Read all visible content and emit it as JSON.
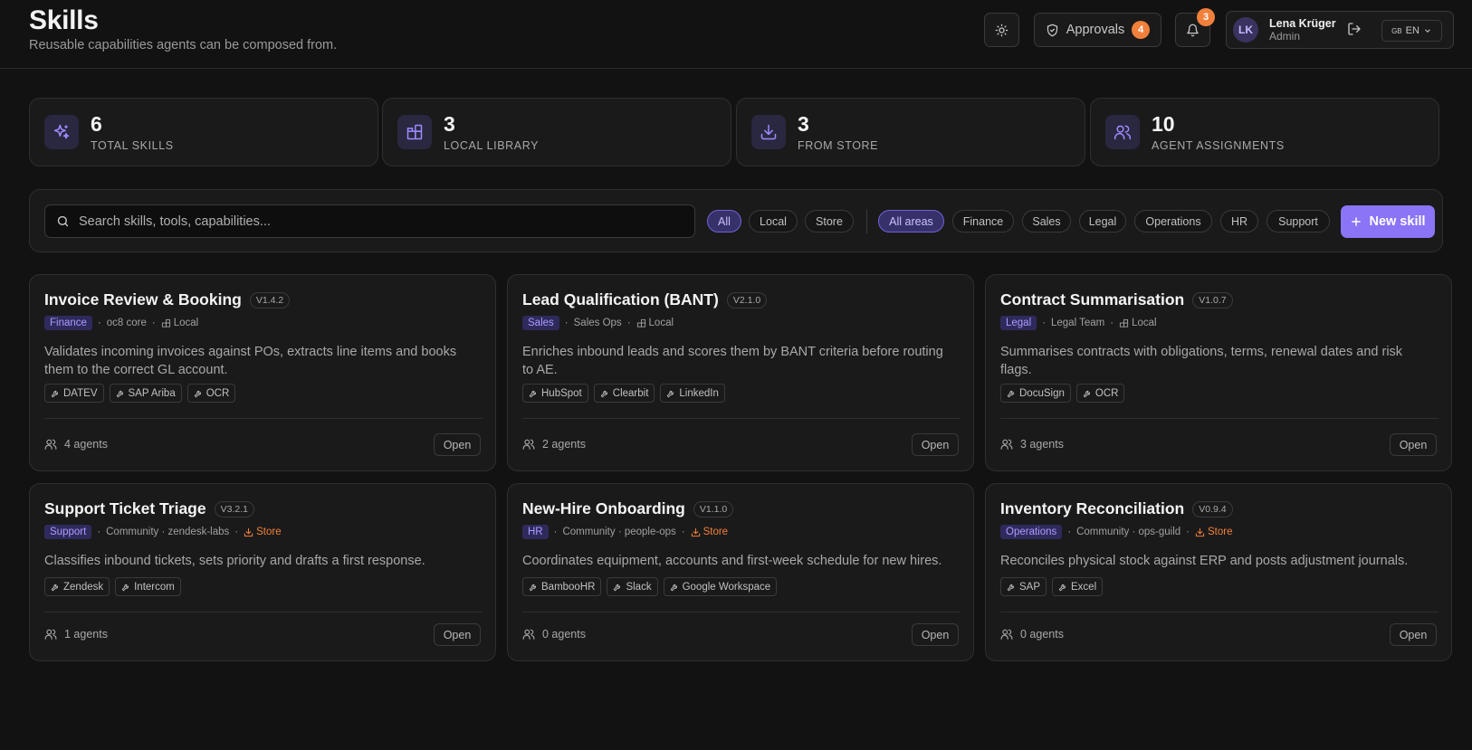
{
  "header": {
    "title": "Skills",
    "subtitle": "Reusable capabilities agents can be composed from.",
    "approvals_label": "Approvals",
    "approvals_count": "4",
    "notifications_count": "3",
    "user": {
      "initials": "LK",
      "name": "Lena Krüger",
      "role": "Admin"
    },
    "language": {
      "flag": "GB",
      "code": "EN"
    }
  },
  "stats": [
    {
      "value": "6",
      "label": "TOTAL SKILLS",
      "icon": "sparkles-icon"
    },
    {
      "value": "3",
      "label": "LOCAL LIBRARY",
      "icon": "blocks-icon"
    },
    {
      "value": "3",
      "label": "FROM STORE",
      "icon": "download-icon"
    },
    {
      "value": "10",
      "label": "AGENT ASSIGNMENTS",
      "icon": "users-icon"
    }
  ],
  "filters": {
    "search_placeholder": "Search skills, tools, capabilities...",
    "source": [
      "All",
      "Local",
      "Store"
    ],
    "source_selected": "All",
    "areas": [
      "All areas",
      "Finance",
      "Sales",
      "Legal",
      "Operations",
      "HR",
      "Support"
    ],
    "area_selected": "All areas",
    "new_skill_label": "New skill"
  },
  "skills": [
    {
      "title": "Invoice Review & Booking",
      "version": "V1.4.2",
      "area": "Finance",
      "owner": "oc8 core",
      "source": "Local",
      "description": "Validates incoming invoices against POs, extracts line items and books them to the correct GL account.",
      "tools": [
        "DATEV",
        "SAP Ariba",
        "OCR"
      ],
      "agents": "4 agents"
    },
    {
      "title": "Lead Qualification (BANT)",
      "version": "V2.1.0",
      "area": "Sales",
      "owner": "Sales Ops",
      "source": "Local",
      "description": "Enriches inbound leads and scores them by BANT criteria before routing to AE.",
      "tools": [
        "HubSpot",
        "Clearbit",
        "LinkedIn"
      ],
      "agents": "2 agents"
    },
    {
      "title": "Contract Summarisation",
      "version": "V1.0.7",
      "area": "Legal",
      "owner": "Legal Team",
      "source": "Local",
      "description": "Summarises contracts with obligations, terms, renewal dates and risk flags.",
      "tools": [
        "DocuSign",
        "OCR"
      ],
      "agents": "3 agents"
    },
    {
      "title": "Support Ticket Triage",
      "version": "V3.2.1",
      "area": "Support",
      "owner": "Community · zendesk-labs",
      "source": "Store",
      "description": "Classifies inbound tickets, sets priority and drafts a first response.",
      "tools": [
        "Zendesk",
        "Intercom"
      ],
      "agents": "1 agents"
    },
    {
      "title": "New-Hire Onboarding",
      "version": "V1.1.0",
      "area": "HR",
      "owner": "Community · people-ops",
      "source": "Store",
      "description": "Coordinates equipment, accounts and first-week schedule for new hires.",
      "tools": [
        "BambooHR",
        "Slack",
        "Google Workspace"
      ],
      "agents": "0 agents"
    },
    {
      "title": "Inventory Reconciliation",
      "version": "V0.9.4",
      "area": "Operations",
      "owner": "Community · ops-guild",
      "source": "Store",
      "description": "Reconciles physical stock against ERP and posts adjustment journals.",
      "tools": [
        "SAP",
        "Excel"
      ],
      "agents": "0 agents"
    }
  ],
  "card_open_label": "Open",
  "colors": {
    "accent": "#8b74f5",
    "badge": "#f0803c",
    "background": "#121212",
    "card": "#1a1a1a"
  }
}
